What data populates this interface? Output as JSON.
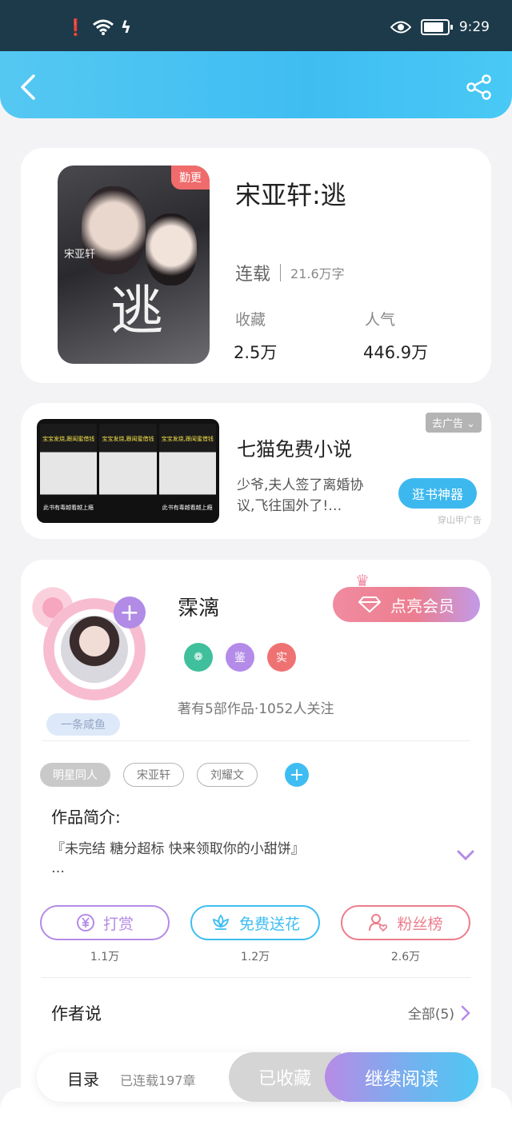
{
  "statusbar": {
    "time": "9:29"
  },
  "book": {
    "tag": "勤更",
    "cover_big": "逃",
    "cover_small": "宋亚轩",
    "title": "宋亚轩:逃",
    "status": "连载",
    "words": "21.6万字",
    "fav_label": "收藏",
    "fav_value": "2.5万",
    "pop_label": "人气",
    "pop_value": "446.9万"
  },
  "ad": {
    "close_label": "去广告",
    "title": "七猫免费小说",
    "desc": "少爷,夫人签了离婚协议,飞往国外了!…",
    "button": "逛书神器",
    "source": "穿山甲广告",
    "panels": [
      {
        "top": "宝宝发烧,跟闺蜜借钱",
        "bottom": "此书有毒越看越上瘾"
      },
      {
        "top": "宝宝发烧,跟闺蜜借钱",
        "bottom": ""
      },
      {
        "top": "宝宝发烧,跟闺蜜借钱",
        "bottom": "此书有毒越看越上瘾"
      }
    ]
  },
  "author": {
    "name": "霂漓",
    "fish_badge": "一条咸鱼",
    "vip_label": "点亮会员",
    "badge2": "鉴",
    "badge3": "实",
    "stats": "著有5部作品·1052人关注",
    "tags": [
      "明星同人",
      "宋亚轩",
      "刘耀文"
    ],
    "intro_label": "作品简介:",
    "intro_text": "『未完结 糖分超标 快来领取你的小甜饼』",
    "intro_more": "…",
    "actions": [
      {
        "label": "打赏",
        "count": "1.1万",
        "color": "#b58ae6"
      },
      {
        "label": "免费送花",
        "count": "1.2万",
        "color": "#3fbdf2"
      },
      {
        "label": "粉丝榜",
        "count": "2.6万",
        "color": "#ee7c8c"
      }
    ],
    "say_label": "作者说",
    "say_all": "全部(5)"
  },
  "bottombar": {
    "toc": "目录",
    "toc_count": "已连载197章",
    "collected": "已收藏",
    "read": "继续阅读"
  }
}
